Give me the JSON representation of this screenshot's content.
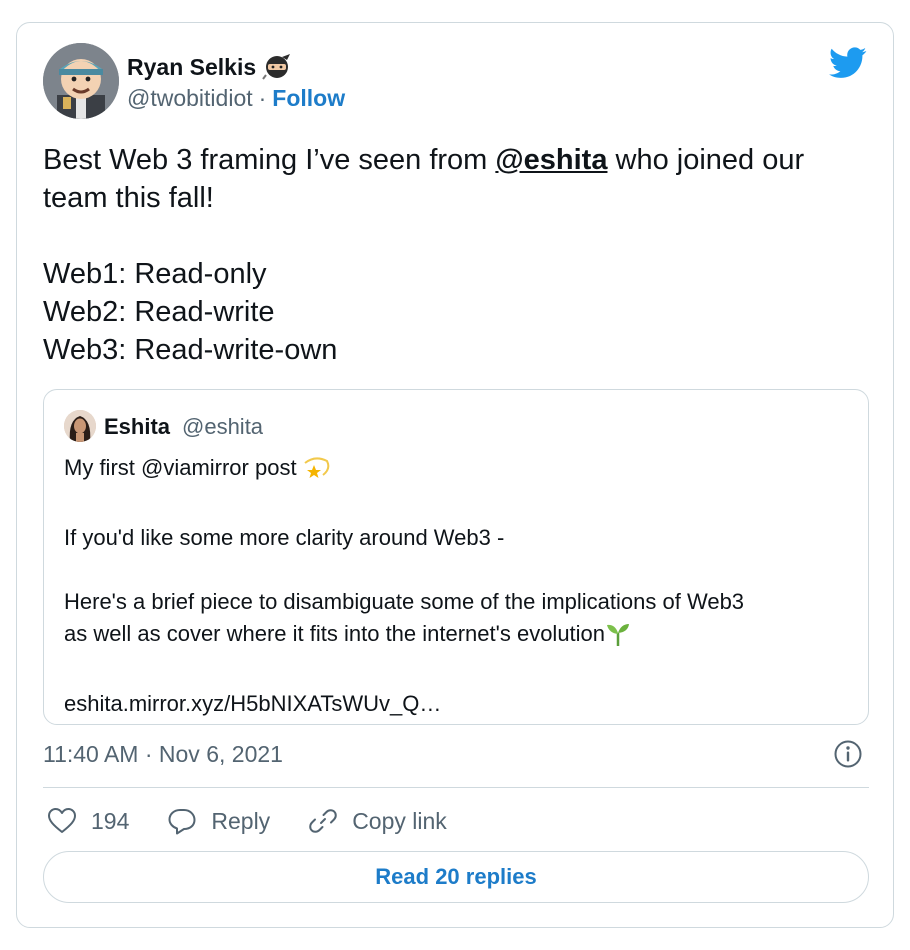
{
  "tweet": {
    "author": {
      "name": "Ryan Selkis",
      "handle": "@twobitidiot",
      "separator": "·",
      "follow_label": "Follow",
      "name_emoji": "ninja-emoji"
    },
    "brand_icon": "twitter-bird-icon",
    "text": {
      "intro_before": "Best Web 3 framing I’ve seen from ",
      "mention": "@eshita",
      "intro_after": " who joined our team this fall!",
      "lines": [
        "Web1: Read-only",
        "Web2: Read-write",
        "Web3: Read-write-own"
      ]
    },
    "quoted": {
      "name": "Eshita",
      "handle": "@eshita",
      "line1": "My first @viamirror post ",
      "line2": "If you'd like some more clarity around Web3 -",
      "line3": "Here's a brief piece to disambiguate some of the implications of Web3",
      "line4": "as well as cover where it fits into the internet's evolution",
      "link": "eshita.mirror.xyz/H5bNIXATsWUv_Q…",
      "emojis": [
        "dizzy-star-emoji",
        "seedling-emoji"
      ]
    },
    "timestamp": "11:40 AM · Nov 6, 2021",
    "actions": {
      "like_count": "194",
      "reply_label": "Reply",
      "copy_link_label": "Copy link"
    },
    "read_replies_label": "Read 20 replies"
  },
  "colors": {
    "link_blue": "#1d7cc9",
    "twitter_blue": "#1d9bf0",
    "secondary_text": "#536471",
    "border": "#cfd9de"
  }
}
